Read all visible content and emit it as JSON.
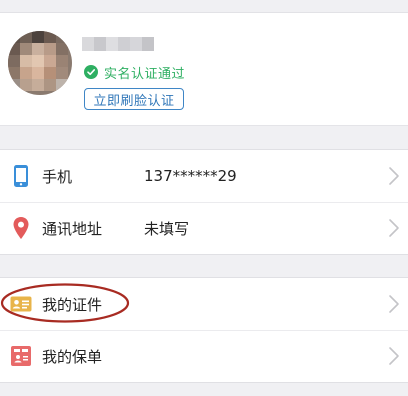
{
  "profile": {
    "verify_status": "实名认证通过",
    "face_auth_button": "立即刷脸认证"
  },
  "contact_section": {
    "items": [
      {
        "icon": "phone-icon",
        "label": "手机",
        "value": "137******29"
      },
      {
        "icon": "location-pin-icon",
        "label": "通讯地址",
        "value": "未填写"
      }
    ]
  },
  "documents_section": {
    "items": [
      {
        "icon": "id-card-icon",
        "label": "我的证件"
      },
      {
        "icon": "policy-icon",
        "label": "我的保单"
      }
    ]
  },
  "colors": {
    "verified_green": "#2eaf62",
    "link_blue": "#2f76b8",
    "phone_icon_blue": "#3a8fd9",
    "location_icon_red": "#e35b5b",
    "id_card_gold": "#e8b44a",
    "policy_red": "#e86a6a",
    "annotation_red": "#a82b22"
  }
}
